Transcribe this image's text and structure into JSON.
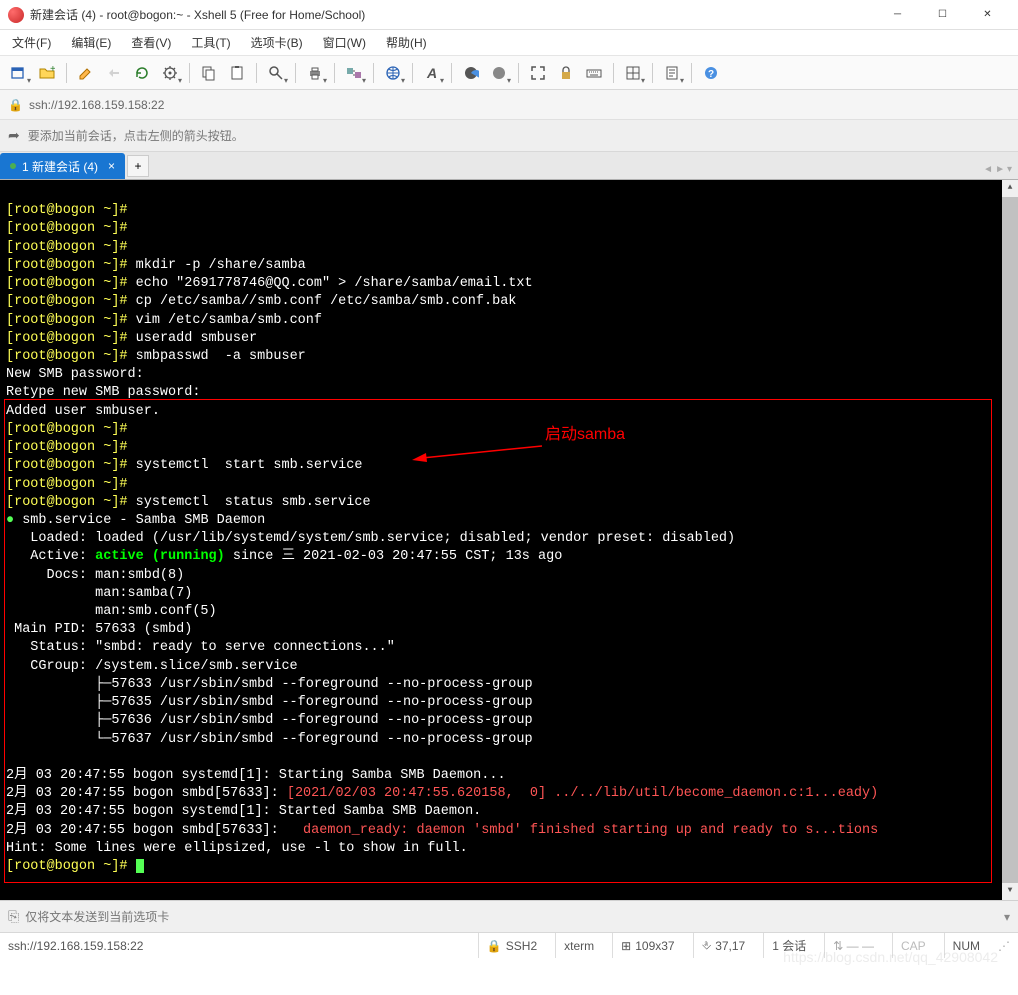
{
  "window": {
    "title": "新建会话 (4) - root@bogon:~ - Xshell 5 (Free for Home/School)"
  },
  "menu": {
    "file": "文件(F)",
    "edit": "编辑(E)",
    "view": "查看(V)",
    "tools": "工具(T)",
    "tabs": "选项卡(B)",
    "window": "窗口(W)",
    "help": "帮助(H)"
  },
  "address": {
    "url": "ssh://192.168.159.158:22"
  },
  "tip": {
    "text": "要添加当前会话，点击左侧的箭头按钮。"
  },
  "tab": {
    "label": "1 新建会话 (4)"
  },
  "annotation": {
    "label": "启动samba"
  },
  "terminal": {
    "prompt": "[root@bogon ~]#",
    "lines": [
      "",
      "",
      "",
      "mkdir -p /share/samba",
      "echo \"2691778746@QQ.com\" > /share/samba/email.txt",
      "cp /etc/samba//smb.conf /etc/samba/smb.conf.bak",
      "vim /etc/samba/smb.conf",
      "useradd smbuser",
      "smbpasswd  -a smbuser"
    ],
    "out1": "New SMB password:",
    "out2": "Retype new SMB password:",
    "out3": "Added user smbuser.",
    "box_lines": [
      "",
      "",
      "systemctl  start smb.service",
      "",
      "systemctl  status smb.service"
    ],
    "status": {
      "l1a": "●",
      "l1b": " smb.service - Samba SMB Daemon",
      "l2": "   Loaded: loaded (/usr/lib/systemd/system/smb.service; disabled; vendor preset: disabled)",
      "l3a": "   Active: ",
      "l3b": "active (running)",
      "l3c": " since 三 2021-02-03 20:47:55 CST; 13s ago",
      "l4": "     Docs: man:smbd(8)",
      "l5": "           man:samba(7)",
      "l6": "           man:smb.conf(5)",
      "l7": " Main PID: 57633 (smbd)",
      "l8": "   Status: \"smbd: ready to serve connections...\"",
      "l9": "   CGroup: /system.slice/smb.service",
      "l10": "           ├─57633 /usr/sbin/smbd --foreground --no-process-group",
      "l11": "           ├─57635 /usr/sbin/smbd --foreground --no-process-group",
      "l12": "           ├─57636 /usr/sbin/smbd --foreground --no-process-group",
      "l13": "           └─57637 /usr/sbin/smbd --foreground --no-process-group",
      "log1": "2月 03 20:47:55 bogon systemd[1]: Starting Samba SMB Daemon...",
      "log2a": "2月 03 20:47:55 bogon smbd[57633]: ",
      "log2b": "[2021/02/03 20:47:55.620158,  0] ../../lib/util/become_daemon.c:1...eady)",
      "log3": "2月 03 20:47:55 bogon systemd[1]: Started Samba SMB Daemon.",
      "log4a": "2月 03 20:47:55 bogon smbd[57633]: ",
      "log4b": "  daemon_ready: daemon 'smbd' finished starting up and ready to s...tions",
      "hint": "Hint: Some lines were ellipsized, use -l to show in full."
    }
  },
  "input": {
    "placeholder": "仅将文本发送到当前选项卡"
  },
  "statusbar": {
    "conn": "ssh://192.168.159.158:22",
    "ssh": "SSH2",
    "term": "xterm",
    "size": "109x37",
    "cursor": "37,17",
    "sess": "1 会话",
    "cap": "CAP",
    "num": "NUM"
  },
  "watermark": "https://blog.csdn.net/qq_42908042"
}
